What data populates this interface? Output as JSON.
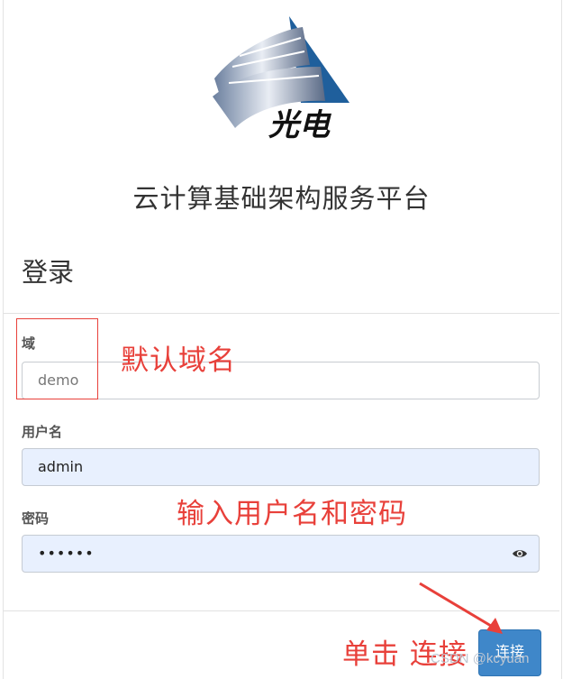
{
  "app": {
    "platform_title": "云计算基础架构服务平台",
    "logo_text": "光电"
  },
  "login": {
    "heading": "登录",
    "domain": {
      "label": "域",
      "value": "demo"
    },
    "username": {
      "label": "用户名",
      "value": "admin"
    },
    "password": {
      "label": "密码",
      "value": "••••••"
    },
    "connect_label": "连接"
  },
  "annotations": {
    "default_domain": "默认域名",
    "enter_credentials": "输入用户名和密码",
    "click_connect": "单击 连接"
  },
  "watermark": "CSDN @kcyuan",
  "colors": {
    "accent": "#3f87c9",
    "annotation": "#e8403a",
    "autofill_bg": "#e8f0fe"
  },
  "icons": {
    "password_toggle": "eye-icon",
    "logo": "logo-icon"
  }
}
